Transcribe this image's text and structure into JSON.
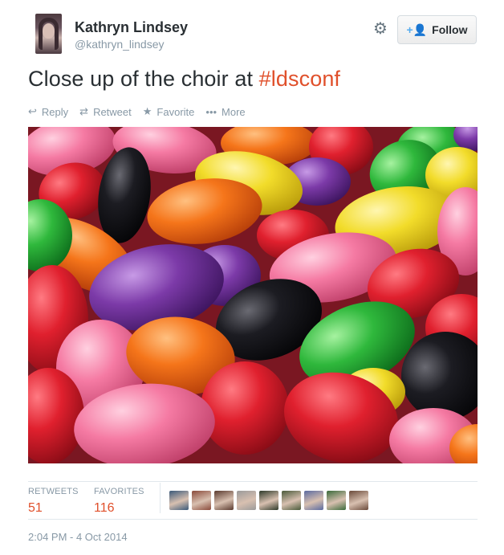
{
  "user": {
    "fullname": "Kathryn Lindsey",
    "username": "@kathryn_lindsey"
  },
  "follow": {
    "label": "Follow",
    "icon": "add-user-icon"
  },
  "settings": {
    "icon": "gear-icon"
  },
  "tweet": {
    "text_prefix": "Close up of the choir at ",
    "hashtag": "#ldsconf"
  },
  "actions": [
    {
      "label": "Reply",
      "icon": "reply-icon"
    },
    {
      "label": "Retweet",
      "icon": "retweet-icon"
    },
    {
      "label": "Favorite",
      "icon": "star-icon"
    },
    {
      "label": "More",
      "icon": "more-icon"
    }
  ],
  "stats": {
    "retweets_label": "RETWEETS",
    "retweets_value": "51",
    "favorites_label": "FAVORITES",
    "favorites_value": "116"
  },
  "favoriters": [
    {
      "color": "#3b5a7a"
    },
    {
      "color": "#8a4a3a"
    },
    {
      "color": "#5a3a2e"
    },
    {
      "color": "#9a9a9a"
    },
    {
      "color": "#2e3a2a"
    },
    {
      "color": "#4a5a3a"
    },
    {
      "color": "#5a6aa0"
    },
    {
      "color": "#3a6a3a"
    },
    {
      "color": "#6a4a3a"
    }
  ],
  "timestamp": "2:04 PM - 4 Oct 2014",
  "colors": {
    "accent": "#e0502b",
    "link_blue": "#55acee",
    "muted": "#8899a6"
  }
}
